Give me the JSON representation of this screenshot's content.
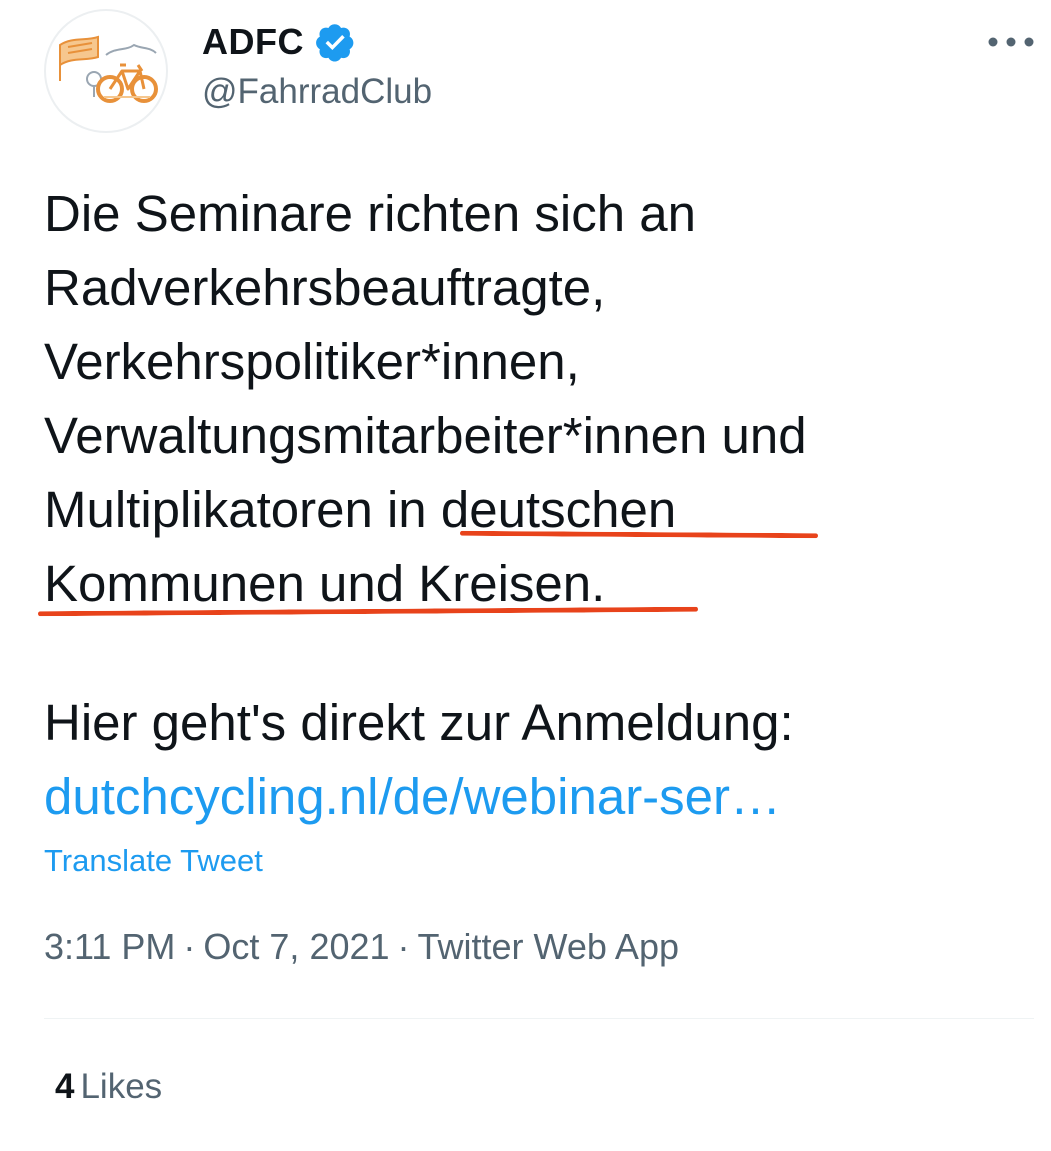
{
  "author": {
    "display_name": "ADFC",
    "handle": "@FahrradClub",
    "verified": true,
    "avatar_icon": "adfc-bicycle-logo-icon"
  },
  "menu": {
    "icon": "more-options-icon"
  },
  "tweet": {
    "lines": [
      "Die Seminare richten sich an",
      "Radverkehrsbeauftragte,",
      "Verkehrspolitiker*innen,",
      "Verwaltungsmitarbeiter*innen und",
      "Multiplikatoren in deutschen",
      "Kommunen und Kreisen."
    ],
    "cta": "Hier geht's direkt zur Anmeldung:",
    "link": "dutchcycling.nl/de/webinar-ser…",
    "translate_label": "Translate Tweet",
    "time": "3:11 PM",
    "date": "Oct 7, 2021",
    "source": "Twitter Web App",
    "separator": "·"
  },
  "engagement": {
    "likes_count": "4",
    "likes_label": "Likes"
  },
  "colors": {
    "text": "#0f1419",
    "secondary": "#536471",
    "link": "#1d9bf0",
    "verified": "#1d9bf0",
    "annotation_underline": "#e8431b"
  }
}
